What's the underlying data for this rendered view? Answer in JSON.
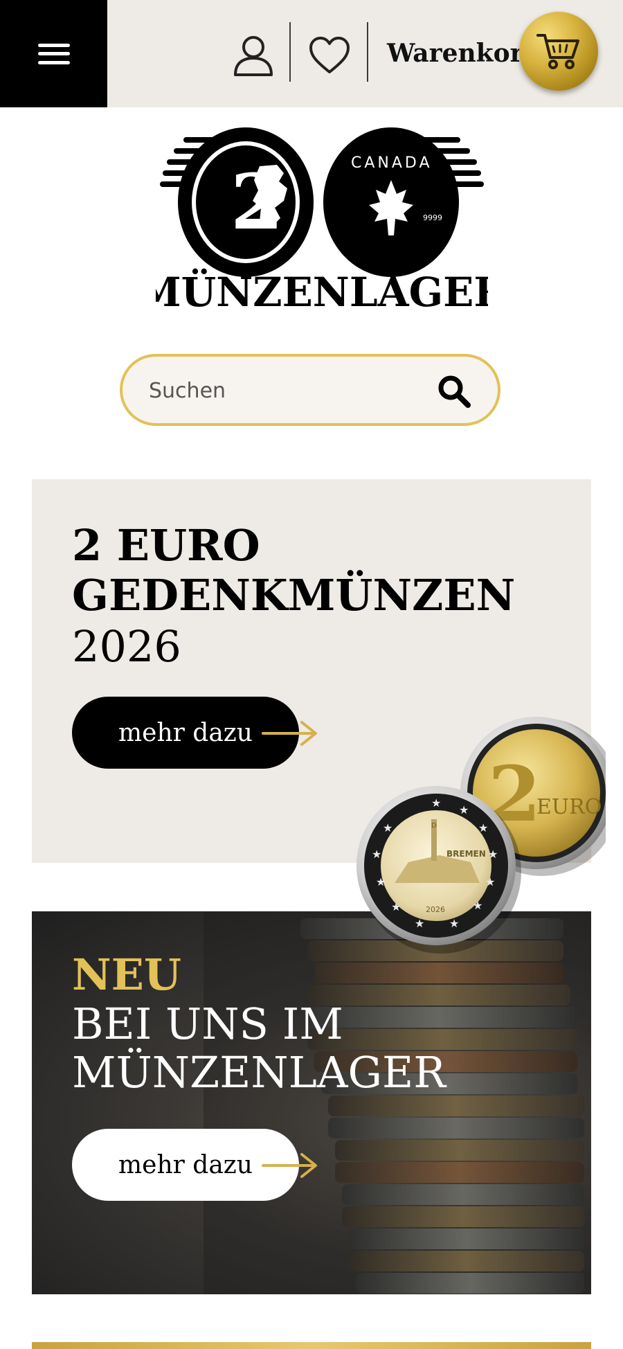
{
  "header": {
    "menu_icon": "hamburger-icon",
    "account_icon": "user-icon",
    "wishlist_icon": "heart-icon",
    "cart_label": "Warenkorb",
    "cart_icon": "cart-icon"
  },
  "logo": {
    "brand": "MÜNZENLAGER",
    "coin_left_text": "2",
    "coin_right_text": "CANADA",
    "coin_right_small": "9999"
  },
  "search": {
    "placeholder": "Suchen",
    "value": "",
    "icon": "search-icon"
  },
  "banner1": {
    "title": "2 EURO GEDENKMÜNZEN",
    "year": "2026",
    "button_label": "mehr dazu",
    "coin_city": "BREMEN",
    "coin_year": "2026",
    "coin_mint": "D",
    "euro_coin_text": "EURO",
    "euro_coin_value": "2"
  },
  "banner2": {
    "kicker": "NEU",
    "title": "BEI UNS IM MÜNZENLAGER",
    "button_label": "mehr dazu"
  },
  "colors": {
    "gold": "#e2c158",
    "header_bg": "#eeeae5",
    "black": "#000000"
  }
}
